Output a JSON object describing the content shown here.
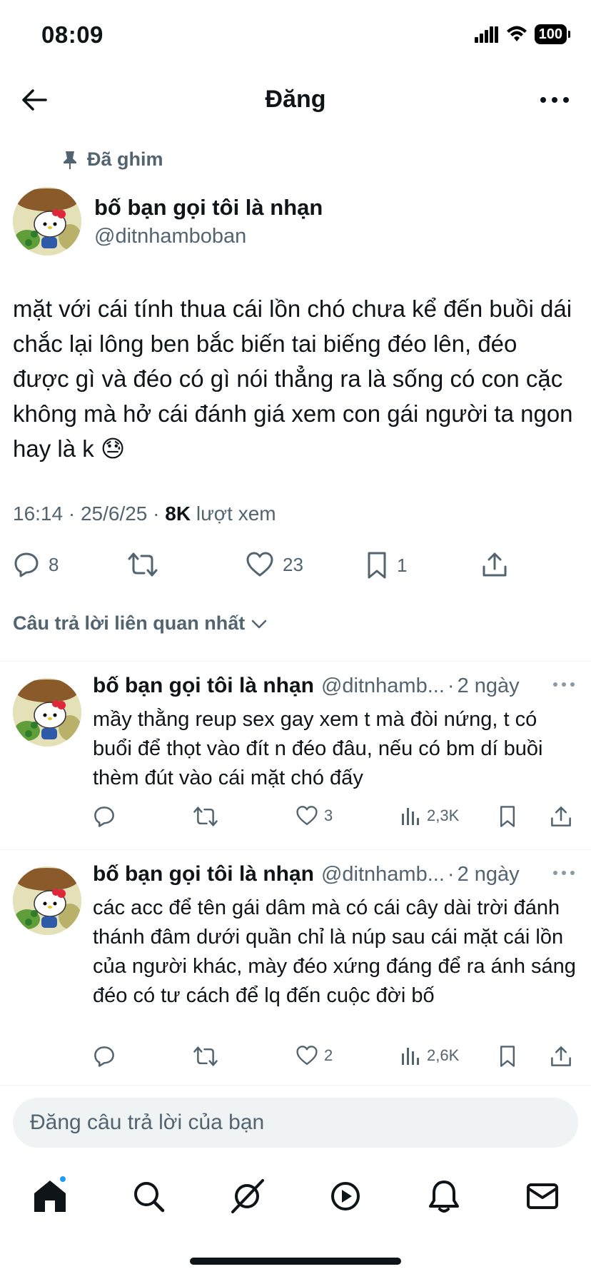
{
  "status": {
    "time": "08:09",
    "battery": "100"
  },
  "header": {
    "title": "Đăng"
  },
  "pinned_label": "Đã ghim",
  "post": {
    "author_name": "bố bạn gọi tôi là nhạn",
    "author_handle": "@ditnhamboban",
    "text": "mặt với cái tính thua cái lồn chó chưa kể đến buồi dái chắc lại lông ben bắc biến tai biếng đéo lên, đéo được gì và đéo có gì nói thẳng ra là sống có con cặc không mà hở cái đánh giá xem con gái người ta ngon hay là k 😓",
    "time": "16:14 · 25/6/25 · ",
    "views_count": "8K",
    "views_label": " lượt xem",
    "replies": "8",
    "likes": "23",
    "bookmarks": "1"
  },
  "sort_label": "Câu trả lời liên quan nhất",
  "replies": [
    {
      "name": "bố bạn gọi tôi là nhạn",
      "handle": "@ditnhamb...",
      "time": "2 ngày",
      "text": "mầy thằng reup sex gay xem t mà đòi nứng, t có buổi để thọt vào đít n đéo đâu, nếu có bm dí buồi thèm đút vào cái mặt chó đấy",
      "likes": "3",
      "views": "2,3K"
    },
    {
      "name": "bố bạn gọi tôi là nhạn",
      "handle": "@ditnhamb...",
      "time": "2 ngày",
      "text": "các acc để tên gái dâm mà có cái cây dài trời đánh thánh đâm dưới quần chỉ là núp sau cái mặt cái lồn của người khác, mày đéo xứng đáng để ra ánh sáng đéo có tư cách để lq đến cuộc đời bố",
      "likes": "2",
      "views": "2,6K"
    }
  ],
  "compose": {
    "placeholder": "Đăng câu trả lời của bạn"
  },
  "colors": {
    "accent": "#1d9bf0",
    "text": "#0f1419",
    "muted": "#536471",
    "divider": "#eff3f4"
  }
}
